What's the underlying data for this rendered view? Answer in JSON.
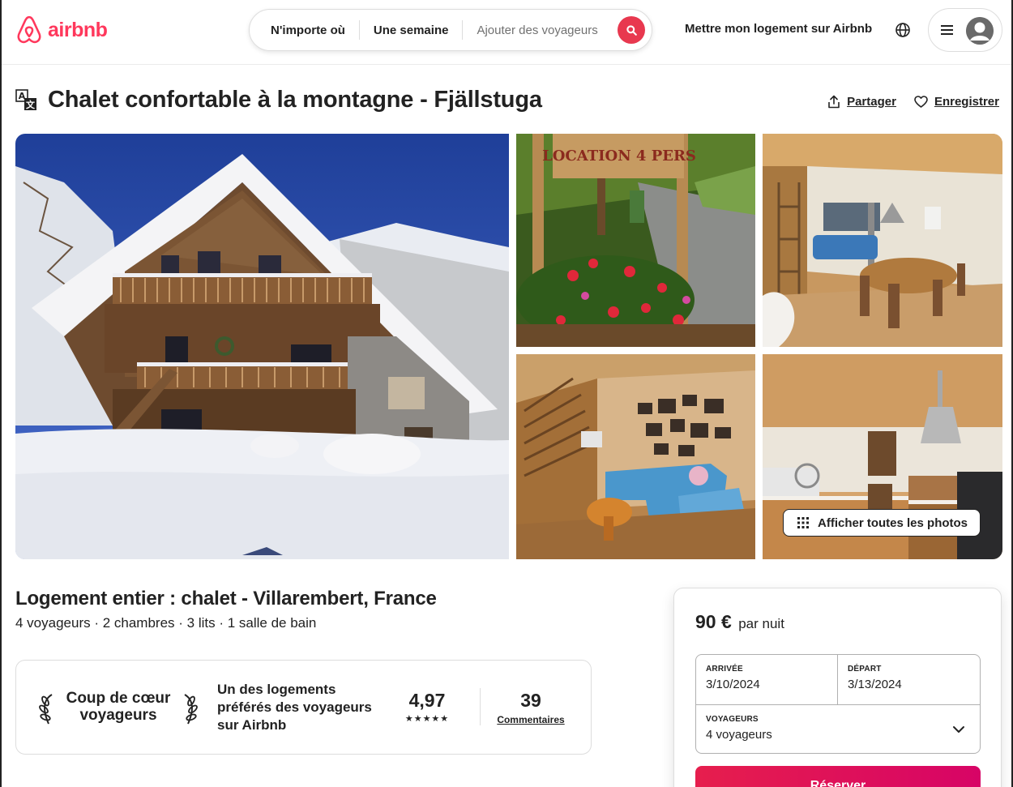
{
  "header": {
    "logo_text": "airbnb",
    "search": {
      "where": "N'importe où",
      "when": "Une semaine",
      "guests_placeholder": "Ajouter des voyageurs"
    },
    "host_link": "Mettre mon logement sur Airbnb"
  },
  "listing": {
    "title": "Chalet confortable à la montagne - Fjällstuga",
    "share_label": "Partager",
    "save_label": "Enregistrer",
    "gallery": {
      "photo2_sign_text": "LOCATION 4 PERS",
      "show_all_label": "Afficher toutes les photos"
    },
    "subtitle": "Logement entier : chalet - Villarembert, France",
    "details": "4 voyageurs · 2 chambres · 3 lits · 1 salle de bain",
    "guest_favorite": {
      "badge_line1": "Coup de cœur",
      "badge_line2": "voyageurs",
      "description": "Un des logements préférés des voyageurs sur Airbnb",
      "rating": "4,97",
      "stars": "★★★★★",
      "reviews_count": "39",
      "reviews_label": "Commentaires"
    }
  },
  "booking": {
    "price": "90 €",
    "price_unit": "par nuit",
    "checkin_label": "ARRIVÉE",
    "checkin_value": "3/10/2024",
    "checkout_label": "DÉPART",
    "checkout_value": "3/13/2024",
    "guests_label": "VOYAGEURS",
    "guests_value": "4 voyageurs",
    "reserve_label": "Réserver"
  },
  "colors": {
    "brand": "#ff385c",
    "search_button": "#e8384f",
    "reserve_start": "#e61e4d",
    "reserve_end": "#d70466",
    "text": "#222222",
    "muted": "#717171"
  },
  "icons": {
    "logo": "airbnb-logo-icon",
    "search": "search-icon",
    "globe": "globe-icon",
    "menu": "hamburger-menu-icon",
    "avatar": "user-avatar-icon",
    "translate": "translate-icon",
    "share": "share-icon",
    "save": "heart-icon",
    "grid": "grid-dots-icon",
    "laurel": "laurel-icon",
    "chevron": "chevron-down-icon"
  }
}
